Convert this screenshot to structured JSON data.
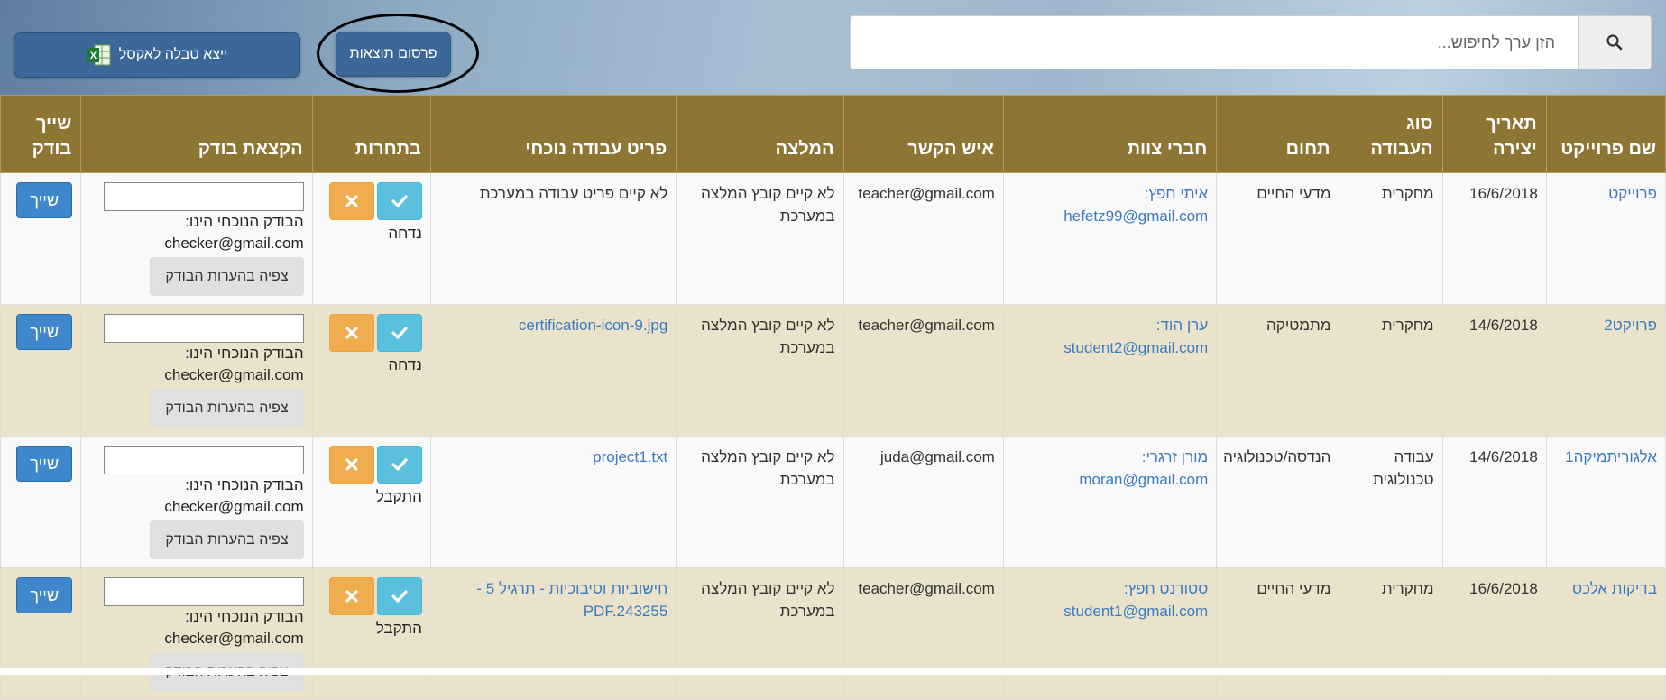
{
  "search": {
    "placeholder": "הזן ערך לחיפוש..."
  },
  "toolbar": {
    "publish_label": "פרסום תוצאות",
    "export_label": "ייצא טבלה לאקסל"
  },
  "table": {
    "headers": {
      "project_name": "שם פרוייקט",
      "created": "תאריך יצירה",
      "work_type": "סוג העבודה",
      "field": "תחום",
      "team": "חברי צוות",
      "contact": "איש הקשר",
      "recommendation": "המלצה",
      "current_item": "פריט עבודה נוכחי",
      "competitions": "בתחרות",
      "assign_checker": "הקצאת בודק",
      "assign": "שייך בודק"
    },
    "rows": [
      {
        "name": "פרוייקט",
        "created": "16/6/2018",
        "work_type": "מחקרית",
        "field": "מדעי החיים",
        "team_name": "איתי חפץ:",
        "team_email": "hefetz99@gmail.com",
        "contact": "teacher@gmail.com",
        "recommendation": "לא קיים קובץ המלצה במערכת",
        "current_item": "לא קיים פריט עבודה במערכת",
        "status": "נדחה",
        "checker_label": "הבודק הנוכחי הינו:",
        "checker_email": "checker@gmail.com",
        "view_notes": "צפיה בהערות הבודק",
        "assign": "שייך"
      },
      {
        "name": "פרויקט2",
        "created": "14/6/2018",
        "work_type": "מחקרית",
        "field": "מתמטיקה",
        "team_name": "ערן הוד:",
        "team_email": "student2@gmail.com",
        "contact": "teacher@gmail.com",
        "recommendation": "לא קיים קובץ המלצה במערכת",
        "current_item": "certification-icon-9.jpg",
        "status": "נדחה",
        "checker_label": "הבודק הנוכחי הינו:",
        "checker_email": "checker@gmail.com",
        "view_notes": "צפיה בהערות הבודק",
        "assign": "שייך"
      },
      {
        "name": "אלגוריתמיקה1",
        "created": "14/6/2018",
        "work_type": "עבודה טכנולוגית",
        "field": "הנדסה/טכנולוגיה",
        "team_name": "מורן זרגרי:",
        "team_email": "moran@gmail.com",
        "contact": "juda@gmail.com",
        "recommendation": "לא קיים קובץ המלצה במערכת",
        "current_item": "project1.txt",
        "status": "התקבל",
        "checker_label": "הבודק הנוכחי הינו:",
        "checker_email": "checker@gmail.com",
        "view_notes": "צפיה בהערות הבודק",
        "assign": "שייך"
      },
      {
        "name": "בדיקות אלכס",
        "created": "16/6/2018",
        "work_type": "מחקרית",
        "field": "מדעי החיים",
        "team_name": "סטודנט חפץ:",
        "team_email": "student1@gmail.com",
        "contact": "teacher@gmail.com",
        "recommendation": "לא קיים קובץ המלצה במערכת",
        "current_item": "חישוביות וסיבוכיות - תרגיל 5 - PDF.243255",
        "status": "התקבל",
        "checker_label": "הבודק הנוכחי הינו:",
        "checker_email": "checker@gmail.com",
        "view_notes": "צפיה בהערות הבודק",
        "assign": "שייך"
      }
    ]
  },
  "colors": {
    "header_bg": "#8f7534",
    "row_alt": "#ebe2cb",
    "primary": "#3b6898",
    "link": "#3a7bc0",
    "accept": "#5bc0de",
    "reject": "#f0ad4e"
  },
  "icons": {
    "search": "search-icon",
    "excel": "excel-icon",
    "check": "check-icon",
    "x": "x-icon"
  }
}
